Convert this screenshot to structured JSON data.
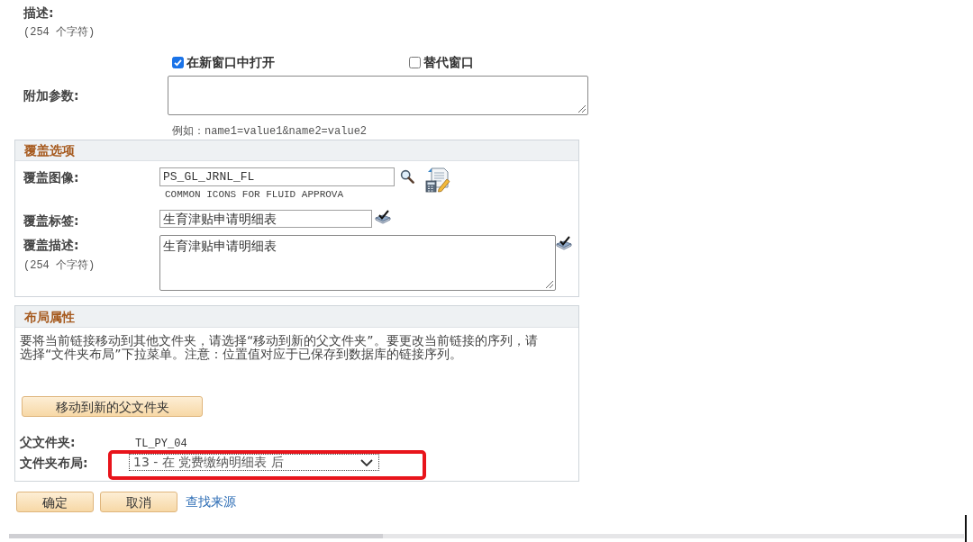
{
  "description": {
    "label": "描述:",
    "hint": "(254 个字符)"
  },
  "options": [
    {
      "label": "在新窗口中打开",
      "checked": true
    },
    {
      "label": "替代窗口",
      "checked": false
    }
  ],
  "additional_params": {
    "label": "附加参数:",
    "example": "例如：name1=value1&name2=value2"
  },
  "override_section": {
    "title": "覆盖选项",
    "image": {
      "label": "覆盖图像:",
      "value": "PS_GL_JRNL_FL",
      "caption": "COMMON ICONS FOR FLUID APPROVA"
    },
    "label_field": {
      "label": "覆盖标签:",
      "value": "生育津贴申请明细表"
    },
    "description_field": {
      "label": "覆盖描述:",
      "hint": "(254 个字符)",
      "value": "生育津贴申请明细表"
    }
  },
  "layout_section": {
    "title": "布局属性",
    "instructions": "要将当前链接移动到其他文件夹，请选择“移动到新的父文件夹”。要更改当前链接的序列，请选择“文件夹布局”下拉菜单。注意：位置值对应于已保存到数据库的链接序列。",
    "move_button": "移动到新的父文件夹",
    "parent_folder": {
      "label": "父文件夹:",
      "value": "TL_PY_04"
    },
    "folder_layout": {
      "label": "文件夹布局:",
      "value": "13 - 在 党费缴纳明细表 后",
      "highlighted": true
    }
  },
  "buttons": [
    {
      "label": "确定"
    },
    {
      "label": "取消"
    }
  ],
  "link": "查找来源"
}
